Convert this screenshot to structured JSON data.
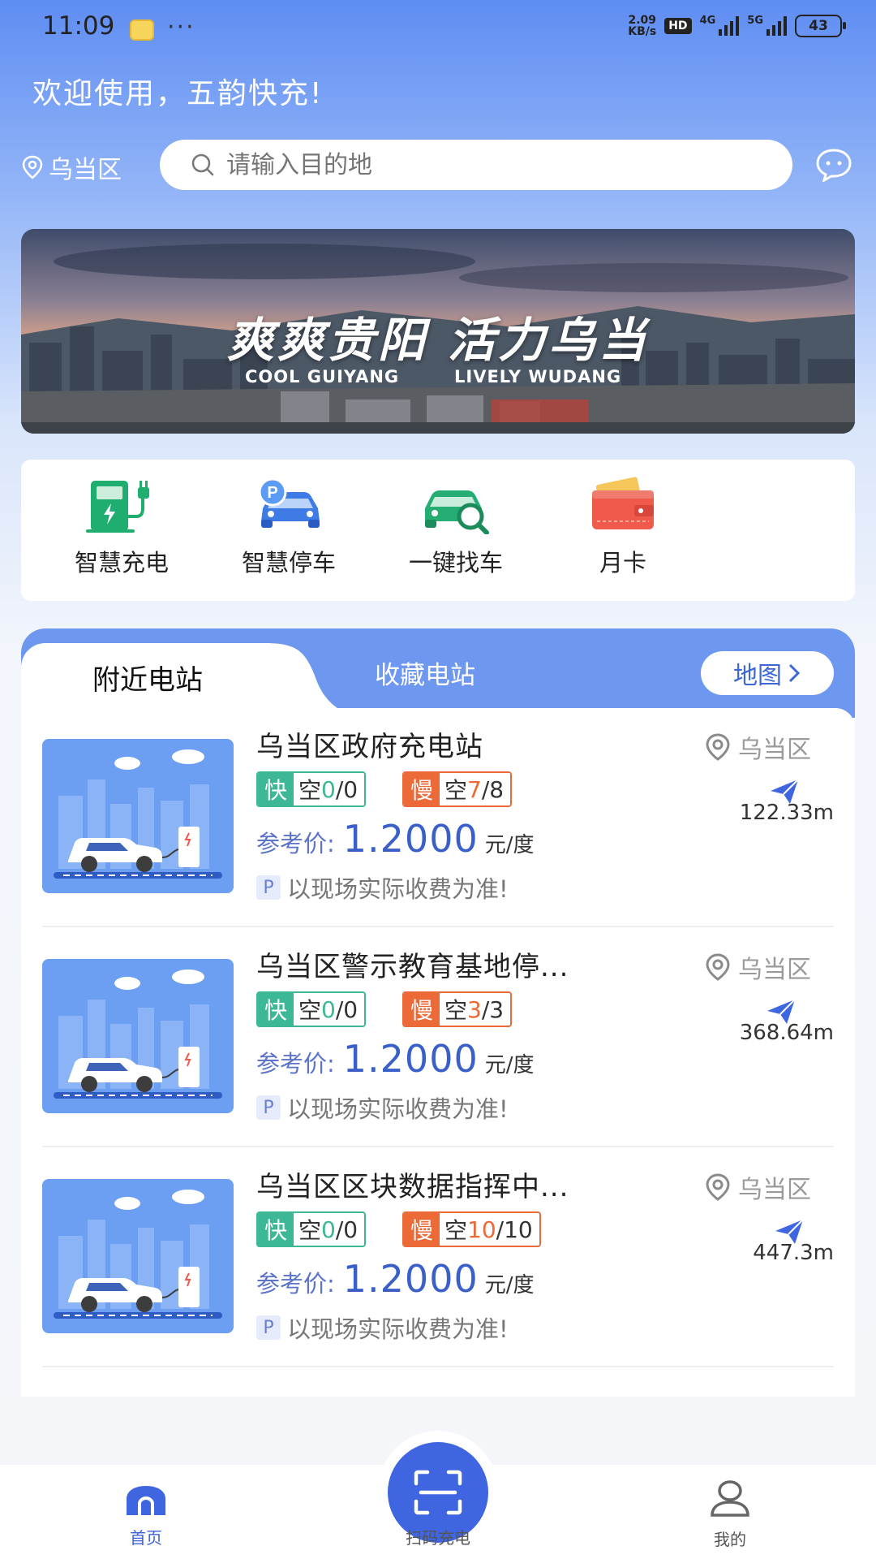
{
  "status_bar": {
    "time": "11:09",
    "dots": "···",
    "net_speed_value": "2.09",
    "net_speed_unit": "KB/s",
    "hd_label": "HD",
    "net1": "4G",
    "net2": "5G",
    "battery": "43"
  },
  "header": {
    "welcome": "欢迎使用，五韵快充!",
    "location": "乌当区",
    "search_placeholder": "请输入目的地"
  },
  "banner": {
    "title": "爽爽贵阳 活力乌当",
    "sub_left": "COOL GUIYANG",
    "sub_right": "LIVELY WUDANG"
  },
  "quick_menu": [
    {
      "label": "智慧充电",
      "icon": "charging-pile-icon"
    },
    {
      "label": "智慧停车",
      "icon": "parking-car-icon"
    },
    {
      "label": "一键找车",
      "icon": "find-car-icon"
    },
    {
      "label": "月卡",
      "icon": "wallet-card-icon"
    }
  ],
  "tabs": {
    "active": "附近电站",
    "other": "收藏电站",
    "map_button": "地图"
  },
  "stations": [
    {
      "name": "乌当区政府充电站",
      "area": "乌当区",
      "fast_tag": "快",
      "fast_prefix": "空",
      "fast_free": "0",
      "fast_total": "/0",
      "slow_tag": "慢",
      "slow_prefix": "空",
      "slow_free": "7",
      "slow_total": "/8",
      "price_label": "参考价:",
      "price": "1.2000",
      "unit": "元/度",
      "note": "以现场实际收费为准!",
      "distance": "122.33m"
    },
    {
      "name": "乌当区警示教育基地停...",
      "area": "乌当区",
      "fast_tag": "快",
      "fast_prefix": "空",
      "fast_free": "0",
      "fast_total": "/0",
      "slow_tag": "慢",
      "slow_prefix": "空",
      "slow_free": "3",
      "slow_total": "/3",
      "price_label": "参考价:",
      "price": "1.2000",
      "unit": "元/度",
      "note": "以现场实际收费为准!",
      "distance": "368.64m"
    },
    {
      "name": "乌当区区块数据指挥中...",
      "area": "乌当区",
      "fast_tag": "快",
      "fast_prefix": "空",
      "fast_free": "0",
      "fast_total": "/0",
      "slow_tag": "慢",
      "slow_prefix": "空",
      "slow_free": "10",
      "slow_total": "/10",
      "price_label": "参考价:",
      "price": "1.2000",
      "unit": "元/度",
      "note": "以现场实际收费为准!",
      "distance": "447.3m"
    }
  ],
  "p_tag": "P",
  "bottom_nav": {
    "home": "首页",
    "scan": "扫码充电",
    "me": "我的"
  },
  "colors": {
    "primary": "#3f66e0",
    "fast": "#3cb896",
    "slow": "#ec6a38"
  }
}
